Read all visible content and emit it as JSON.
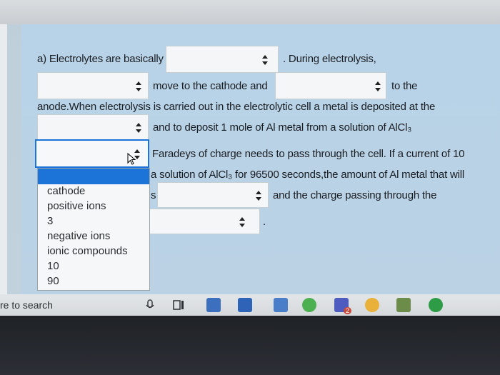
{
  "question": {
    "line1_before": "a) Electrolytes are basically",
    "line1_after": ". During electrolysis,",
    "line2_mid": "move to the cathode and",
    "line2_end": "to the",
    "line3": "anode.When electrolysis is carried out in the electrolytic cell a metal is deposited at the",
    "line4": "and to deposit 1 mole of Al metal from a solution of AlCl₃",
    "line5": "Faradeys of charge needs to pass through the cell. If a current of 10",
    "line6": "a solution of AlCl₃ for 96500 seconds,the amount of Al metal that will",
    "line7_s": "s",
    "line7_end": "and the charge passing through the",
    "line8_end": "."
  },
  "dropdown": {
    "options": [
      "cathode",
      "positive ions",
      "3",
      "negative ions",
      "ionic compounds",
      "10",
      "90"
    ]
  },
  "taskbar": {
    "search_text": "re to search",
    "teams_badge": "2"
  },
  "colors": {
    "panel": "#b8d3e8",
    "highlight": "#1c74d9",
    "edge": "#4caf50",
    "store": "#2f63b8"
  }
}
